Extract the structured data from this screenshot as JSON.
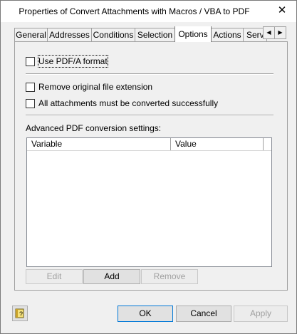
{
  "window": {
    "title": "Properties of Convert Attachments with Macros / VBA to PDF",
    "close_glyph": "✕"
  },
  "tabs": [
    {
      "label": "General"
    },
    {
      "label": "Addresses"
    },
    {
      "label": "Conditions"
    },
    {
      "label": "Selection"
    },
    {
      "label": "Options",
      "active": true
    },
    {
      "label": "Actions"
    },
    {
      "label": "Serv"
    }
  ],
  "tab_scroll": {
    "left_glyph": "◀",
    "right_glyph": "▶"
  },
  "options": {
    "use_pdfa": {
      "label": "Use PDF/A format",
      "checked": false
    },
    "remove_extension": {
      "label": "Remove original file extension",
      "checked": false
    },
    "all_converted": {
      "label": "All attachments must be converted successfully",
      "checked": false
    }
  },
  "advanced": {
    "label": "Advanced PDF conversion settings:",
    "columns": [
      "Variable",
      "Value"
    ],
    "rows": []
  },
  "list_buttons": {
    "edit": "Edit",
    "add": "Add",
    "remove": "Remove"
  },
  "footer": {
    "ok": "OK",
    "cancel": "Cancel",
    "apply": "Apply",
    "help_icon": "help-book-icon"
  }
}
